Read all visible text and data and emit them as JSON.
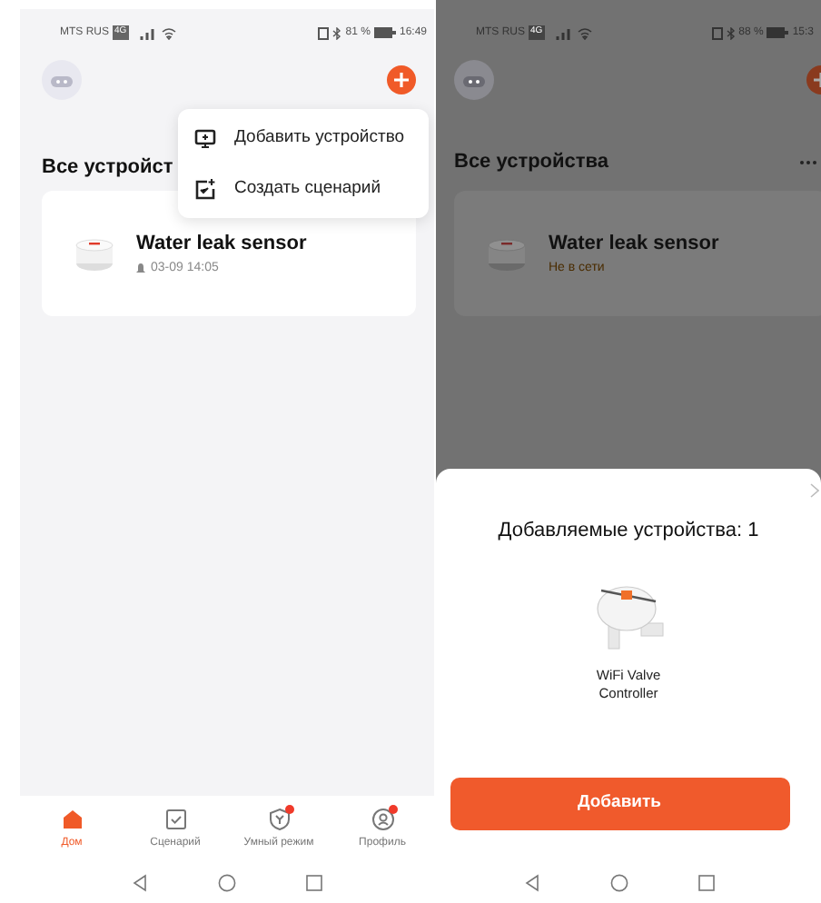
{
  "left_screen": {
    "status_bar": {
      "carrier": "MTS RUS",
      "network": "4G",
      "battery": "81 %",
      "time": "16:49"
    },
    "add_menu": [
      {
        "kind": "device",
        "label": "Добавить устройство"
      },
      {
        "kind": "scene",
        "label": "Создать сценарий"
      }
    ],
    "section_title": "Все устройст",
    "devices": [
      {
        "name": "Water leak sensor",
        "kind": "event",
        "status": "03-09 14:05"
      }
    ],
    "bottom_nav": [
      {
        "kind": "home",
        "label": "Дом",
        "selected": true,
        "badge": false
      },
      {
        "kind": "scenes",
        "label": "Сценарий",
        "selected": false,
        "badge": false
      },
      {
        "kind": "smart",
        "label": "Умный режим",
        "selected": false,
        "badge": true
      },
      {
        "kind": "profile",
        "label": "Профиль",
        "selected": false,
        "badge": true
      }
    ]
  },
  "right_screen": {
    "status_bar": {
      "carrier": "MTS RUS",
      "network": "4G",
      "battery": "88 %",
      "time": "15:3"
    },
    "section_title": "Все устройства",
    "devices": [
      {
        "name": "Water leak sensor",
        "kind": "offline",
        "status": "Не в сети"
      }
    ],
    "sheet": {
      "title": "Добавляемые устройства: 1",
      "found_device": "WiFi Valve Controller",
      "add_button": "Добавить"
    }
  }
}
